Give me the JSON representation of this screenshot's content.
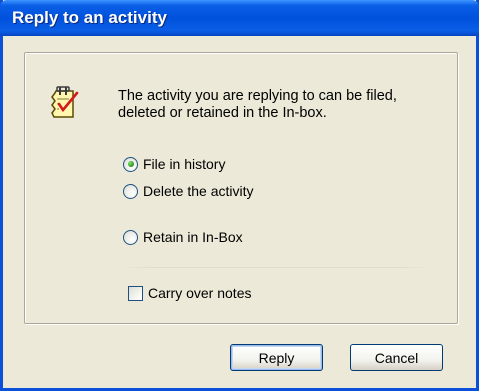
{
  "dialog": {
    "title": "Reply to an activity",
    "message": "The activity you are replying to can be filed, deleted or retained in the In-box.",
    "icon": "document-check-icon",
    "options": [
      {
        "label": "File in history",
        "checked": true
      },
      {
        "label": "Delete the activity",
        "checked": false
      },
      {
        "label": "Retain in In-Box",
        "checked": false
      }
    ],
    "carry_over": {
      "label": "Carry over notes",
      "checked": false
    },
    "buttons": {
      "reply": "Reply",
      "cancel": "Cancel"
    }
  },
  "colors": {
    "titlebar": "#0051dc",
    "window_bg": "#ece9d8",
    "border": "#0a50d8"
  }
}
